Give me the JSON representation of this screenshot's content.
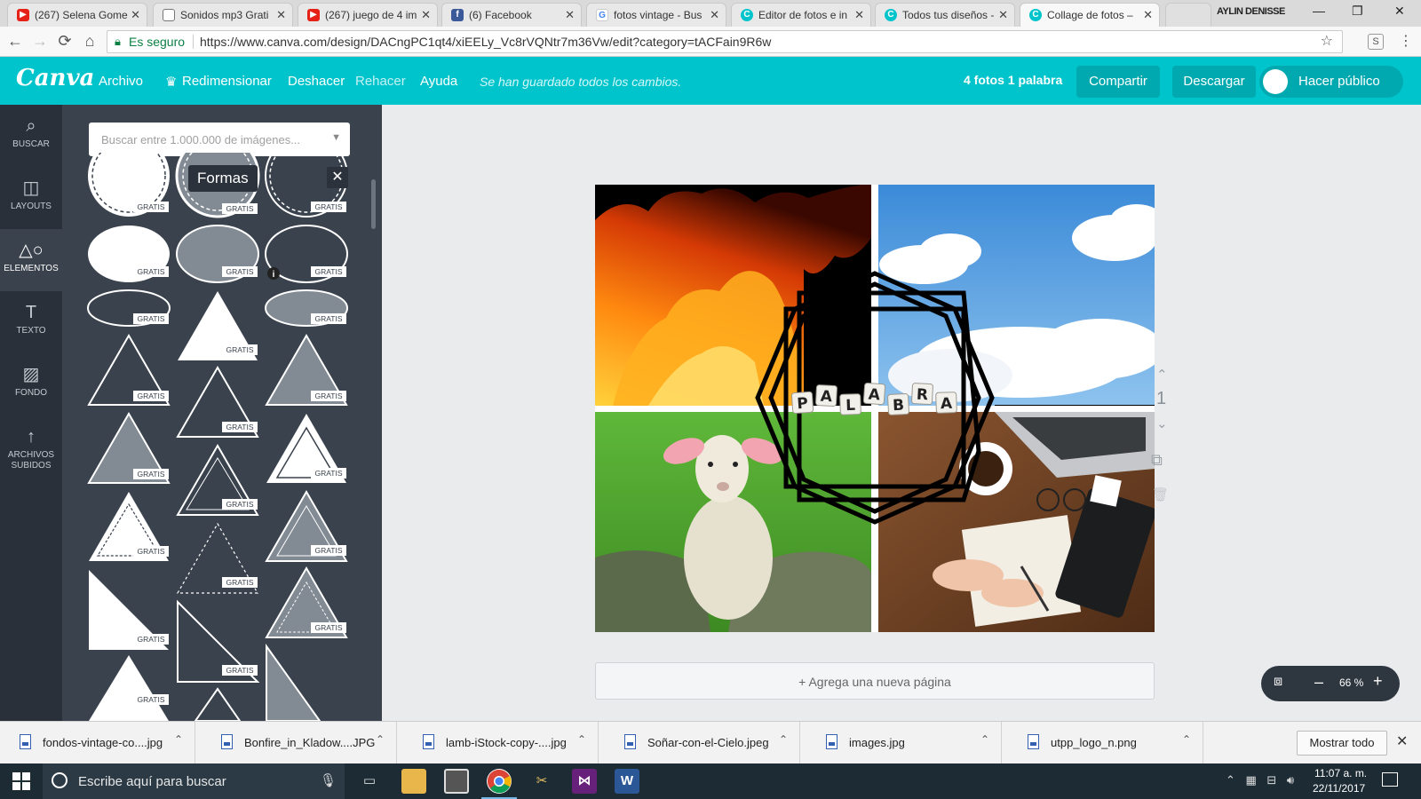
{
  "browser": {
    "tabs": [
      {
        "title": "(267) Selena Gome",
        "icon": "youtube-icon"
      },
      {
        "title": "Sonidos mp3 Grati",
        "icon": "document-icon"
      },
      {
        "title": "(267) juego de 4 im",
        "icon": "youtube-icon"
      },
      {
        "title": "(6) Facebook",
        "icon": "facebook-icon"
      },
      {
        "title": "fotos vintage - Bus",
        "icon": "google-icon"
      },
      {
        "title": "Editor de fotos e in",
        "icon": "canva-icon"
      },
      {
        "title": "Todos tus diseños -",
        "icon": "canva-icon"
      },
      {
        "title": "Collage de fotos –",
        "icon": "canva-icon",
        "active": true
      }
    ],
    "profile_name": "AYLIN DENISSE",
    "secure_label": "Es seguro",
    "url": "https://www.canva.com/design/DACngPC1qt4/xiEELy_Vc8rVQNtr7m36Vw/edit?category=tACFain9R6w",
    "extension_label": "S"
  },
  "canva": {
    "logo": "Canva",
    "menu": {
      "file": "Archivo",
      "resize": "Redimensionar",
      "undo": "Deshacer",
      "redo": "Rehacer",
      "help": "Ayuda"
    },
    "saved_message": "Se han guardado todos los cambios.",
    "design_title": "4 fotos 1 palabra",
    "share_label": "Compartir",
    "download_label": "Descargar",
    "public_label": "Hacer público"
  },
  "rail": [
    {
      "label": "BUSCAR",
      "icon": "search-icon"
    },
    {
      "label": "LAYOUTS",
      "icon": "layouts-icon"
    },
    {
      "label": "ELEMENTOS",
      "icon": "elements-icon",
      "active": true
    },
    {
      "label": "TEXTO",
      "icon": "text-icon"
    },
    {
      "label": "FONDO",
      "icon": "background-icon"
    },
    {
      "label": "ARCHIVOS SUBIDOS",
      "icon": "upload-icon"
    }
  ],
  "panel": {
    "search_placeholder": "Buscar entre 1.000.000 de imágenes...",
    "tooltip": "Formas",
    "badge": "GRATIS"
  },
  "canvas": {
    "word": "PALABRA",
    "letters": [
      "P",
      "A",
      "L",
      "A",
      "B",
      "R",
      "A"
    ],
    "page_number": "1",
    "add_page_label": "+ Agrega una nueva página",
    "zoom": "66 %"
  },
  "downloads": [
    "fondos-vintage-co....jpg",
    "Bonfire_in_Kladow....JPG",
    "lamb-iStock-copy-....jpg",
    "Soñar-con-el-Cielo.jpeg",
    "images.jpg",
    "utpp_logo_n.png"
  ],
  "show_all_label": "Mostrar todo",
  "taskbar": {
    "search_placeholder": "Escribe aquí para buscar",
    "time": "11:07 a. m.",
    "date": "22/11/2017"
  },
  "colors": {
    "canva_teal": "#00c4cc",
    "button_teal": "#00a9b0",
    "rail_dark": "#293039",
    "panel_dark": "#3a424d"
  }
}
